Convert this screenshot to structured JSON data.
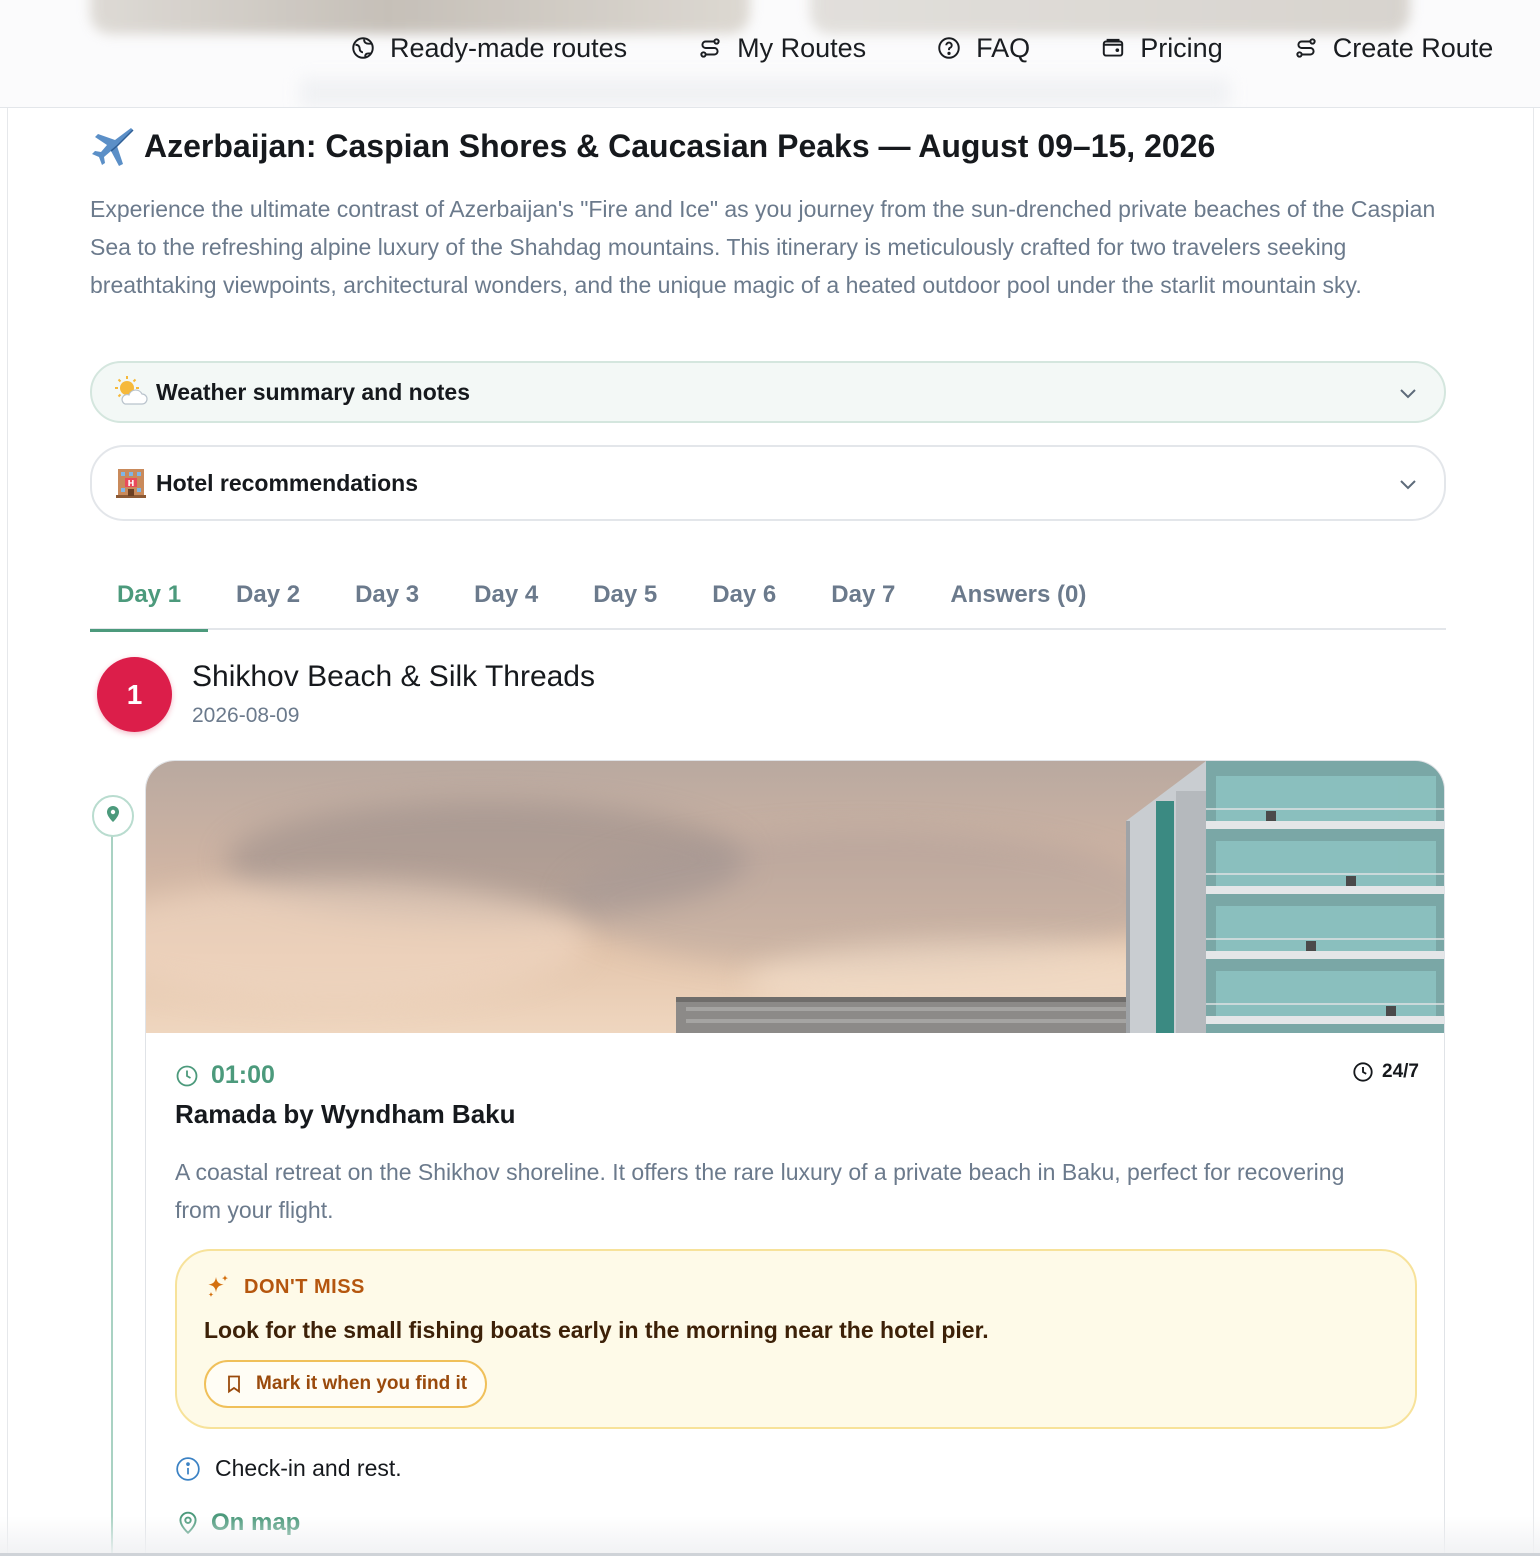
{
  "nav": {
    "items": [
      {
        "label": "Ready-made routes",
        "icon": "globe-icon"
      },
      {
        "label": "My Routes",
        "icon": "route-icon"
      },
      {
        "label": "FAQ",
        "icon": "help-circle-icon"
      },
      {
        "label": "Pricing",
        "icon": "wallet-icon"
      },
      {
        "label": "Create Route",
        "icon": "route-icon"
      }
    ]
  },
  "trip": {
    "title": "Azerbaijan: Caspian Shores & Caucasian Peaks — August 09–15, 2026",
    "title_icon": "airplane-icon",
    "description": "Experience the ultimate contrast of Azerbaijan's \"Fire and Ice\" as you journey from the sun-drenched private beaches of the Caspian Sea to the refreshing alpine luxury of the Shahdag mountains. This itinerary is meticulously crafted for two travelers seeking breathtaking viewpoints, architectural wonders, and the unique magic of a heated outdoor pool under the starlit mountain sky."
  },
  "accordions": {
    "weather": {
      "label": "Weather summary and notes",
      "icon": "sun-cloud-icon"
    },
    "hotels": {
      "label": "Hotel recommendations",
      "icon": "hotel-icon"
    }
  },
  "tabs": [
    {
      "label": "Day 1",
      "active": true
    },
    {
      "label": "Day 2",
      "active": false
    },
    {
      "label": "Day 3",
      "active": false
    },
    {
      "label": "Day 4",
      "active": false
    },
    {
      "label": "Day 5",
      "active": false
    },
    {
      "label": "Day 6",
      "active": false
    },
    {
      "label": "Day 7",
      "active": false
    },
    {
      "label": "Answers (0)",
      "active": false
    }
  ],
  "day": {
    "number": "1",
    "title": "Shikhov Beach & Silk Threads",
    "date": "2026-08-09"
  },
  "stop": {
    "time": "01:00",
    "hours": "24/7",
    "name": "Ramada by Wyndham Baku",
    "description": "A coastal retreat on the Shikhov shoreline. It offers the rare luxury of a private beach in Baku, perfect for recovering from your flight.",
    "dont_miss": {
      "label": "DON'T MISS",
      "text": "Look for the small fishing boats early in the morning near the hotel pier.",
      "button": "Mark it when you find it"
    },
    "note": "Check-in and rest.",
    "map_link": "On map"
  },
  "colors": {
    "accent": "#4c9a7c",
    "day_badge": "#dc1e4a",
    "dont_miss_bg": "#fefae8",
    "dont_miss_border": "#f7e29a",
    "muted_text": "#6b7a8c"
  }
}
